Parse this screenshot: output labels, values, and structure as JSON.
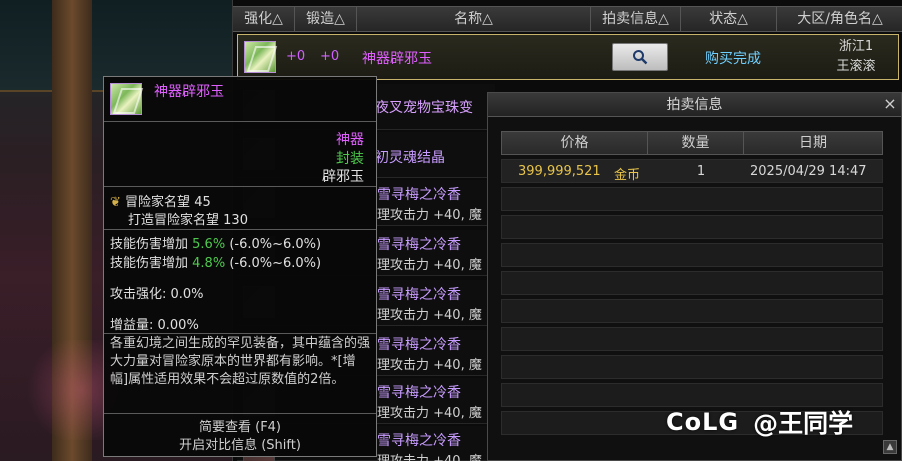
{
  "list": {
    "headers": {
      "strengthen": "强化△",
      "forge": "锻造△",
      "name": "名称△",
      "auction_info": "拍卖信息△",
      "status": "状态△",
      "region": "大区/角色名△"
    },
    "top_row": {
      "strengthen": "+0",
      "forge": "+0",
      "name": "神器辟邪玉",
      "status": "购买完成",
      "region_line1": "浙江1",
      "region_line2": "王滚滚"
    },
    "rows": [
      {
        "name": "夜叉宠物宝珠变",
        "stat": ""
      },
      {
        "name": "初灵魂结晶",
        "stat": ""
      },
      {
        "name": "雪寻梅之冷香",
        "stat": "理攻击力 +40, 魔"
      },
      {
        "name": "雪寻梅之冷香",
        "stat": "理攻击力 +40, 魔"
      },
      {
        "name": "雪寻梅之冷香",
        "stat": "理攻击力 +40, 魔"
      },
      {
        "name": "雪寻梅之冷香",
        "stat": "理攻击力 +40, 魔"
      },
      {
        "name": "雪寻梅之冷香",
        "stat": "理攻击力 +40, 魔"
      },
      {
        "name": "雪寻梅之冷香",
        "stat": "理攻击力 +40, 魔"
      }
    ]
  },
  "auction_info": {
    "title": "拍卖信息",
    "close": "×",
    "headers": {
      "price": "价格",
      "quantity": "数量",
      "date": "日期"
    },
    "records": [
      {
        "price": "399,999,521",
        "currency": "金币",
        "quantity": "1",
        "date": "2025/04/29 14:47"
      }
    ]
  },
  "tooltip": {
    "name": "神器辟邪玉",
    "rarity": "神器",
    "seal": "封装",
    "type": "辟邪玉",
    "reputation_label": "冒险家名望",
    "reputation_value": "45",
    "forge_reputation_label": "打造冒险家名望",
    "forge_reputation_value": "130",
    "skill_lines": [
      {
        "label": "技能伤害增加",
        "value": "5.6%",
        "range": "(-6.0%~6.0%)"
      },
      {
        "label": "技能伤害增加",
        "value": "4.8%",
        "range": "(-6.0%~6.0%)"
      }
    ],
    "attack_enhance": "攻击强化: 0.0%",
    "buff_amount": "增益量: 0.00%",
    "description": "各重幻境之间生成的罕见装备，其中蕴含的强大力量对冒险家原本的世界都有影响。*[增幅]属性适用效果不会超过原数值的2倍。",
    "footer_line1": "简要查看 (F4)",
    "footer_line2": "开启对比信息 (Shift)"
  },
  "watermark": {
    "logo": "CoLG",
    "text": "@王同学"
  }
}
